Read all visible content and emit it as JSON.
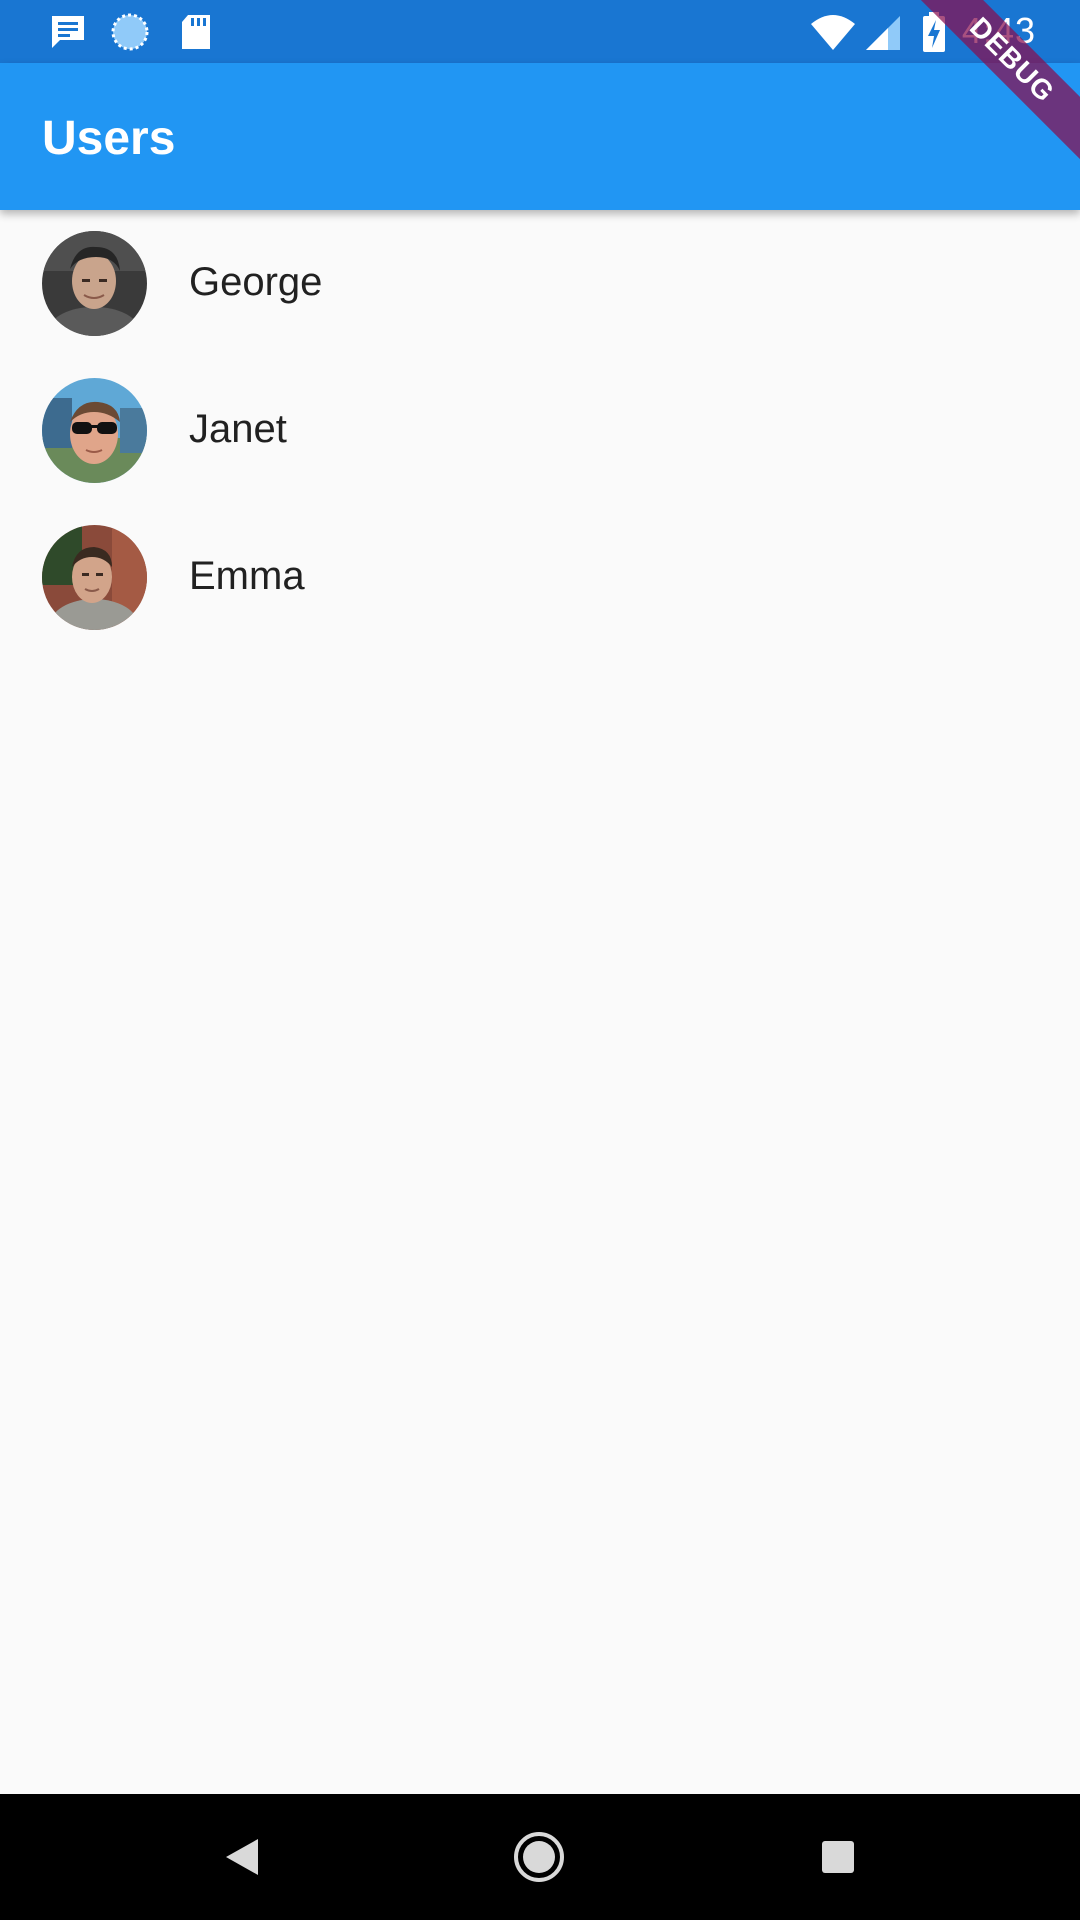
{
  "status_bar": {
    "time": "4:43",
    "icons": [
      "notification-icon",
      "sync-icon",
      "sd-card-icon",
      "wifi-icon",
      "signal-icon",
      "battery-charging-icon"
    ]
  },
  "app_bar": {
    "title": "Users"
  },
  "debug_banner": {
    "label": "DEBUG"
  },
  "users": [
    {
      "name": "George"
    },
    {
      "name": "Janet"
    },
    {
      "name": "Emma"
    }
  ],
  "nav_bar": {
    "buttons": [
      "back-icon",
      "home-icon",
      "recents-icon"
    ]
  },
  "colors": {
    "status_bar": "#1976d2",
    "app_bar": "#2196f3",
    "background": "#fafafa",
    "text": "#212121",
    "debug_ribbon": "#880e4f"
  }
}
